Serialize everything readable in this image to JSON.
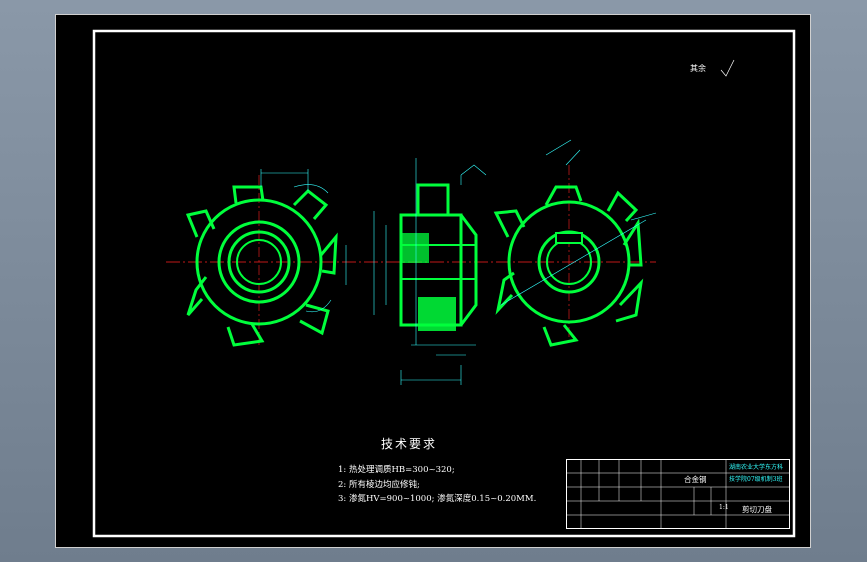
{
  "surface_note": "其余",
  "tech": {
    "title": "技术要求",
    "notes": [
      "1: 热处理调质HB=300~320;",
      "2: 所有棱边均应修钝;",
      "3: 渗氮HV=900~1000; 渗氮深度0.15~0.20MM."
    ]
  },
  "title_block": {
    "material": "合金钢",
    "school": [
      "湖南农业大学东方科",
      "技学院07级机制3班"
    ],
    "part_name": "剪切刀盘",
    "scale": "1:1"
  },
  "colors": {
    "sheet": "#000000",
    "part": "#00ff3c",
    "dimension": "#00ffff",
    "centerline": "#ff2020",
    "border": "#ffffff"
  }
}
